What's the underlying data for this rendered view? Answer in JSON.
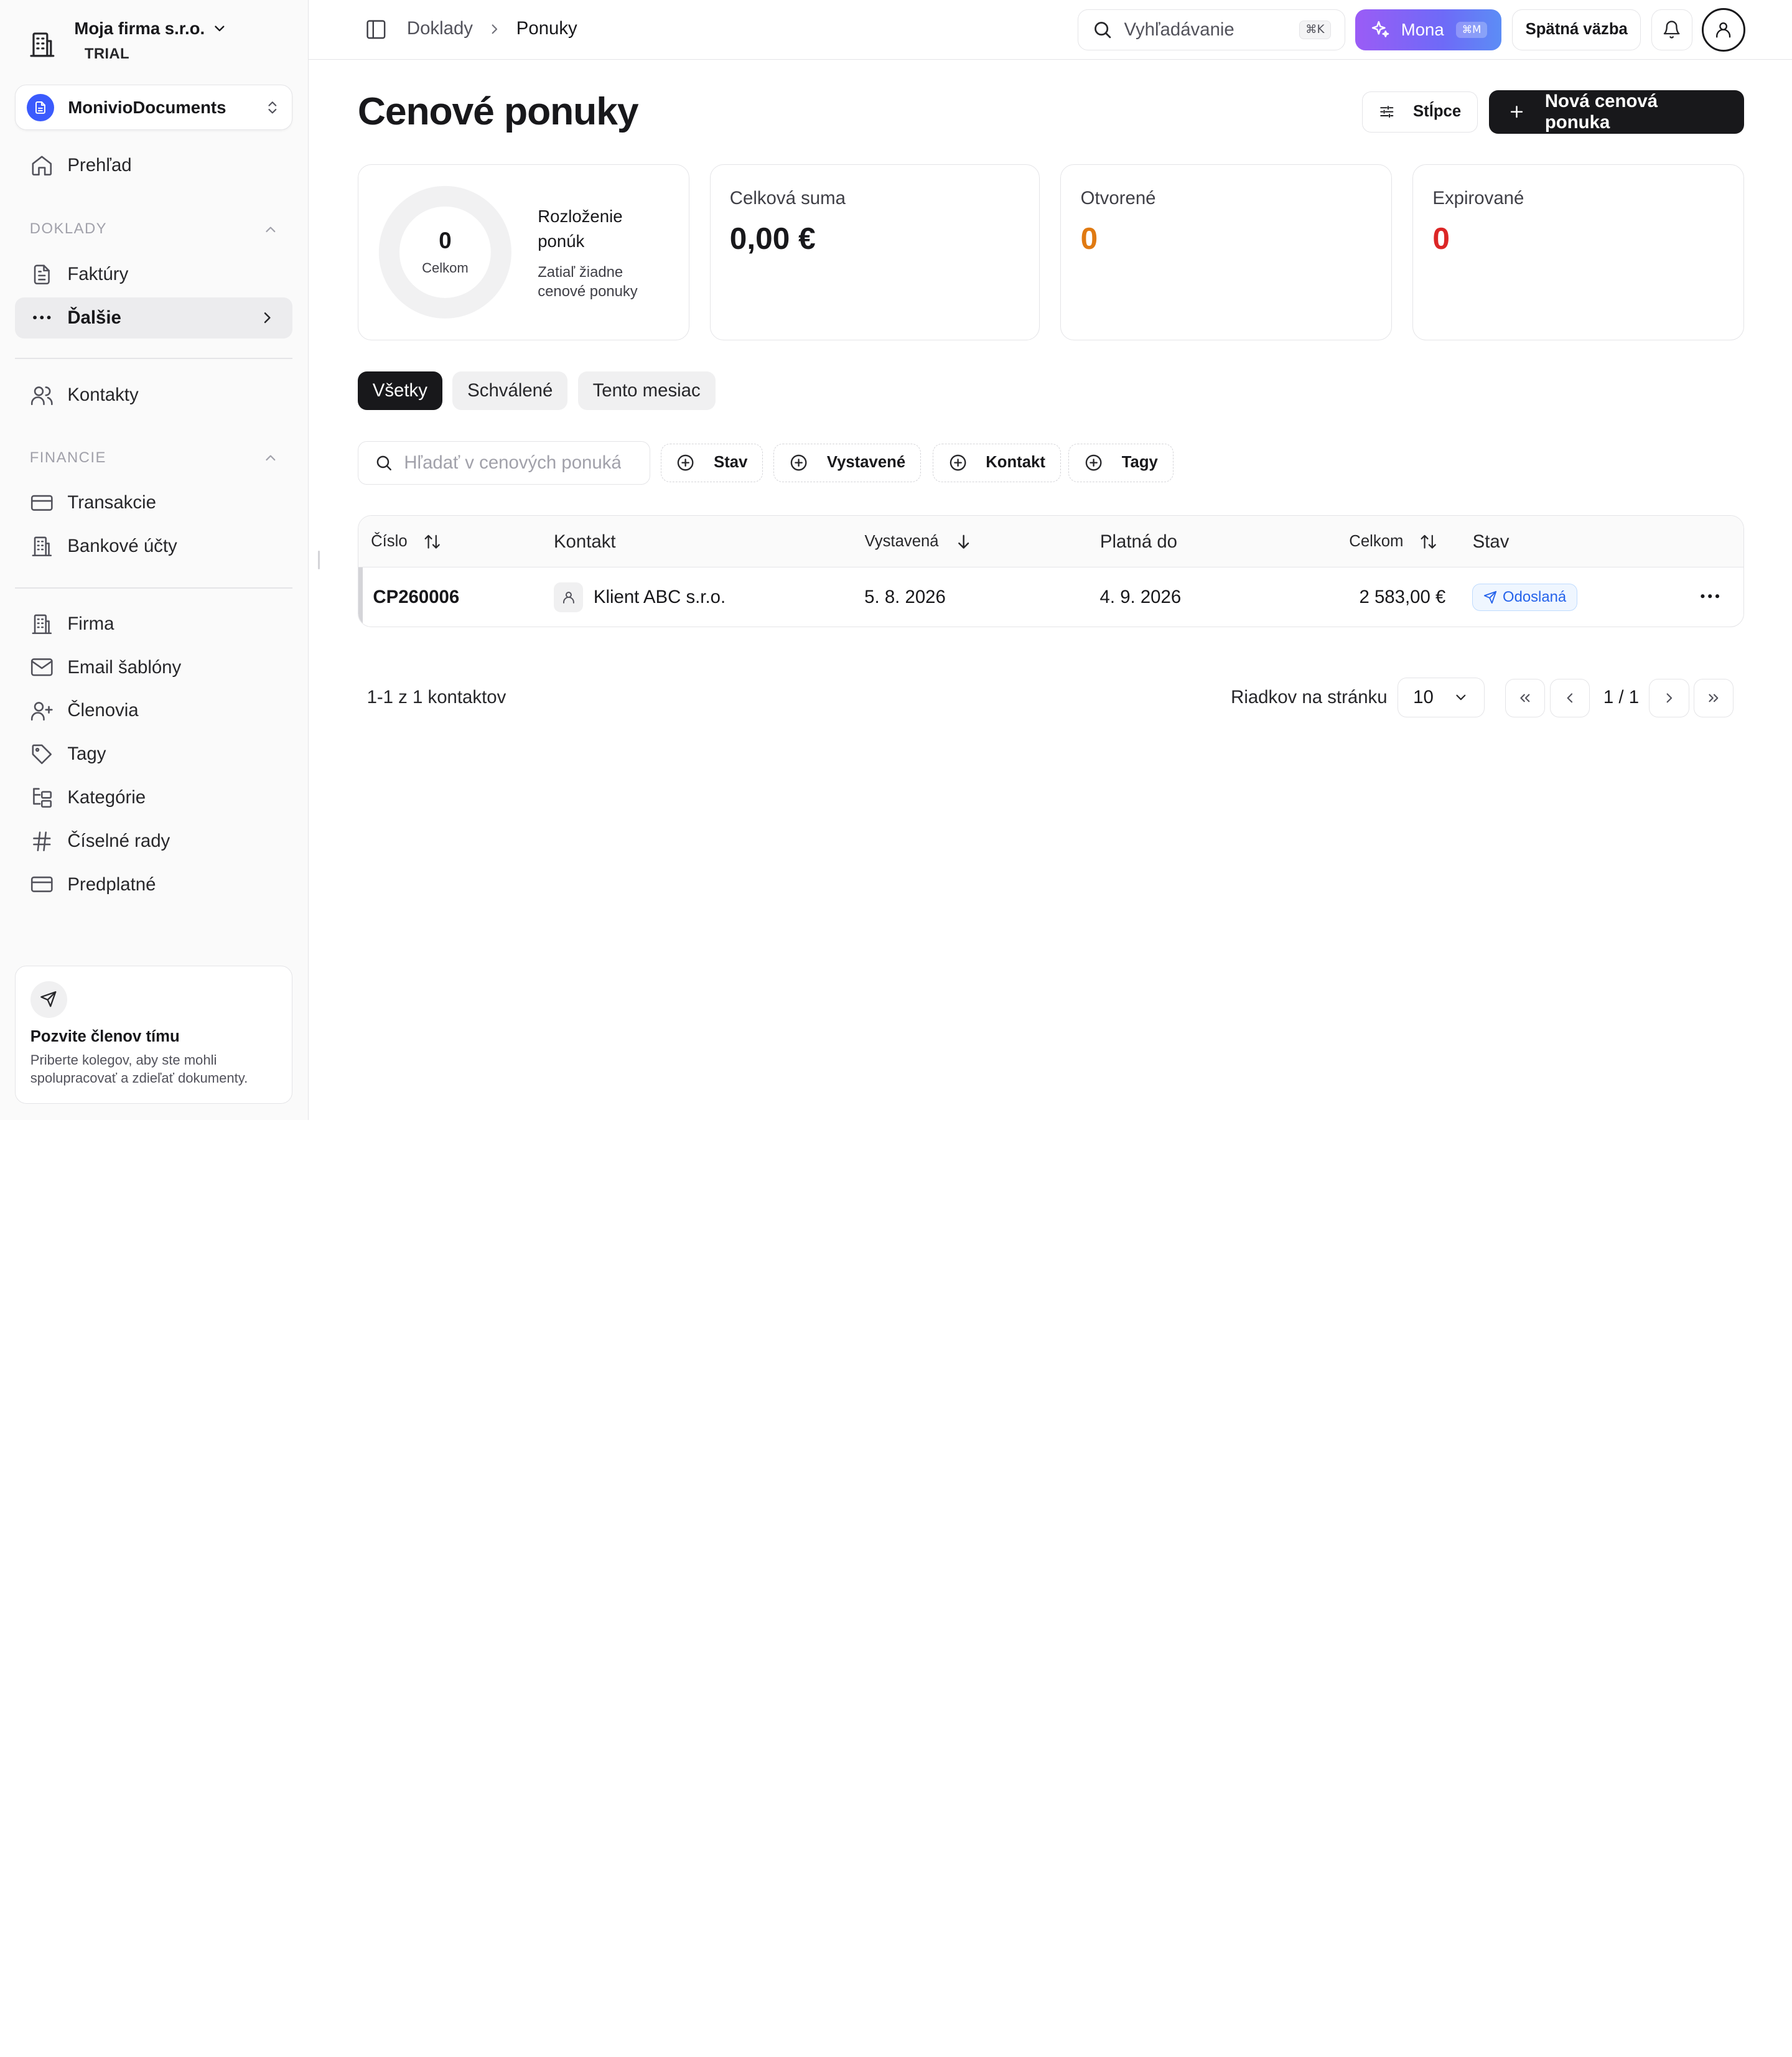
{
  "sidebar": {
    "company_name": "Moja firma s.r.o.",
    "plan_badge": "TRIAL",
    "workspace": "MonivioDocuments",
    "overview": "Prehľad",
    "section_doklady": "DOKLADY",
    "invoices": "Faktúry",
    "more": "Ďalšie",
    "contacts": "Kontakty",
    "section_financie": "FINANCIE",
    "transactions": "Transakcie",
    "bank_accounts": "Bankové účty",
    "company": "Firma",
    "email_templates": "Email šablóny",
    "members": "Členovia",
    "tags": "Tagy",
    "categories": "Kategórie",
    "number_series": "Číselné rady",
    "subscription": "Predplatné",
    "invite_title": "Pozvite členov tímu",
    "invite_desc": "Priberte kolegov, aby ste mohli spolupracovať a zdieľať dokumenty."
  },
  "topbar": {
    "breadcrumb_parent": "Doklady",
    "breadcrumb_current": "Ponuky",
    "search_placeholder": "Vyhľadávanie",
    "search_shortcut": "⌘K",
    "ai_label": "Mona",
    "ai_shortcut": "⌘M",
    "feedback_label": "Spätná väzba"
  },
  "page": {
    "title": "Cenové ponuky",
    "columns_button": "Stĺpce",
    "new_button": "Nová cenová ponuka"
  },
  "stats": {
    "donut_value": "0",
    "donut_label": "Celkom",
    "distribution_title": "Rozloženie ponúk",
    "distribution_desc": "Zatiaľ žiadne cenové ponuky",
    "total_title": "Celková suma",
    "total_value": "0,00 €",
    "open_title": "Otvorené",
    "open_value": "0",
    "expired_title": "Expirované",
    "expired_value": "0",
    "open_color": "#e07a12",
    "expired_color": "#dc2626"
  },
  "tabs": {
    "all": "Všetky",
    "approved": "Schválené",
    "this_month": "Tento mesiac"
  },
  "filters": {
    "search_placeholder": "Hľadať v cenových ponukách",
    "status": "Stav",
    "issued": "Vystavené",
    "contact": "Kontakt",
    "tags": "Tagy"
  },
  "table": {
    "headers": {
      "number": "Číslo",
      "contact": "Kontakt",
      "issued": "Vystavená",
      "valid_until": "Platná do",
      "total": "Celkom",
      "status": "Stav"
    },
    "rows": [
      {
        "number": "CP260006",
        "contact": "Klient ABC s.r.o.",
        "issued": "5. 8. 2026",
        "valid_until": "4. 9. 2026",
        "total": "2 583,00 €",
        "status": "Odoslaná"
      }
    ]
  },
  "pagination": {
    "info": "1-1 z 1 kontaktov",
    "rows_label": "Riadkov na stránku",
    "rows_value": "10",
    "page": "1 / 1"
  }
}
